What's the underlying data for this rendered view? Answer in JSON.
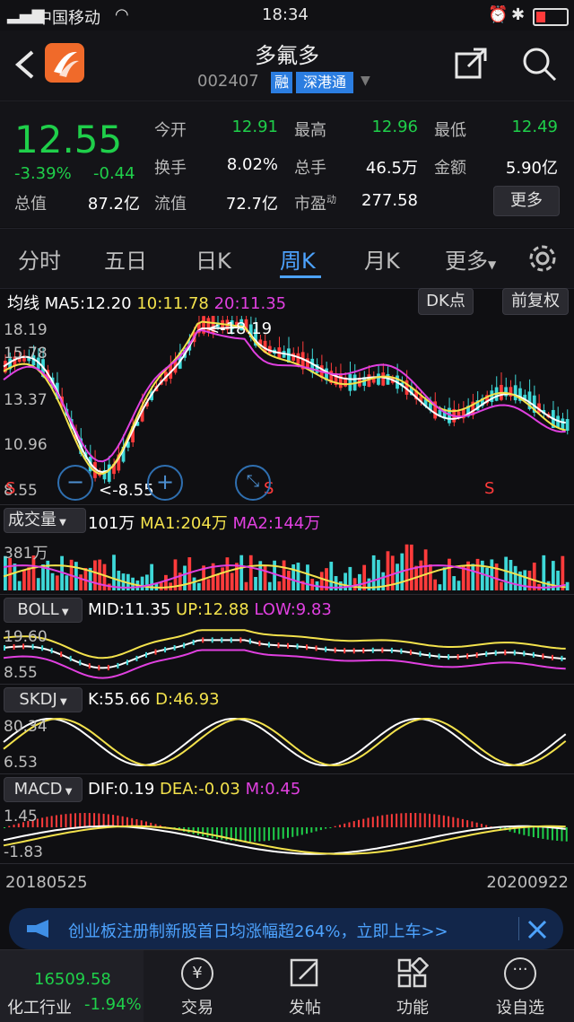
{
  "status_bar": {
    "carrier": "中国移动",
    "time": "18:34"
  },
  "header": {
    "stock_name": "多氟多",
    "stock_code": "002407",
    "badge_rong": "融",
    "badge_sgt": "深港通"
  },
  "quote": {
    "price": "12.55",
    "change_pct": "-3.39%",
    "change": "-0.44",
    "total_value_label": "总值",
    "total_value": "87.2亿",
    "open_label": "今开",
    "open": "12.91",
    "high_label": "最高",
    "high": "12.96",
    "low_label": "最低",
    "low": "12.49",
    "turnover_rate_label": "换手",
    "turnover_rate": "8.02%",
    "volume_label": "总手",
    "volume": "46.5万",
    "amount_label": "金额",
    "amount": "5.90亿",
    "float_value_label": "流值",
    "float_value": "72.7亿",
    "pe_label": "市盈",
    "pe_sup": "动",
    "pe": "277.58",
    "more_button": "更多"
  },
  "tabs": [
    {
      "label": "分时",
      "active": false
    },
    {
      "label": "五日",
      "active": false
    },
    {
      "label": "日K",
      "active": false
    },
    {
      "label": "周K",
      "active": true
    },
    {
      "label": "月K",
      "active": false
    },
    {
      "label": "更多",
      "active": false
    }
  ],
  "main_chart": {
    "ma_title": "均线",
    "ma5": "MA5:12.20",
    "ma10": "10:11.78",
    "ma20": "20:11.35",
    "dk_button": "DK点",
    "fq_button": "前复权",
    "y_labels": [
      "18.19",
      "15.78",
      "13.37",
      "10.96",
      "8.55"
    ],
    "high_annotation": "<-18.19",
    "low_annotation": "<-8.55",
    "s_marks": [
      "S",
      "S",
      "S"
    ]
  },
  "volume_panel": {
    "label": "成交量",
    "value": "101万",
    "ma1": "MA1:204万",
    "ma2": "MA2:144万",
    "y_top": "381万"
  },
  "boll_panel": {
    "label": "BOLL",
    "mid": "MID:11.35",
    "up": "UP:12.88",
    "low": "LOW:9.83",
    "y_top": "19.60",
    "y_bottom": "8.55"
  },
  "skdj_panel": {
    "label": "SKDJ",
    "k": "K:55.66",
    "d": "D:46.93",
    "y_top": "80.34",
    "y_bottom": "6.53"
  },
  "macd_panel": {
    "label": "MACD",
    "dif": "DIF:0.19",
    "dea": "DEA:-0.03",
    "m": "M:0.45",
    "y_top": "1.45",
    "y_bottom": "-1.83"
  },
  "date_range": {
    "start": "20180525",
    "end": "20200922"
  },
  "banner": {
    "text": "创业板注册制新股首日均涨幅超264%，立即上车>>"
  },
  "bottom_bar": {
    "index_value": "16509.58",
    "sector_label": "化工行业",
    "sector_change": "-1.94%",
    "nav": [
      {
        "label": "交易",
        "icon": "trade-icon"
      },
      {
        "label": "发帖",
        "icon": "post-icon"
      },
      {
        "label": "功能",
        "icon": "function-icon"
      },
      {
        "label": "设自选",
        "icon": "add-watchlist-icon"
      }
    ]
  },
  "colors": {
    "up": "#ff3b3b",
    "down": "#1fcf4a",
    "accent": "#4da3ff",
    "ma5": "#ffffff",
    "ma10": "#f3e24c",
    "ma20": "#e040e0"
  }
}
